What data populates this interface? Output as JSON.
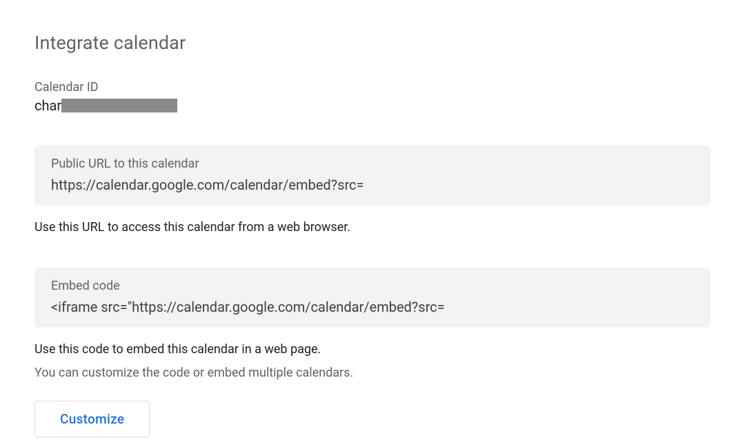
{
  "section": {
    "title": "Integrate calendar"
  },
  "calendar_id": {
    "label": "Calendar ID",
    "visible_prefix": "char"
  },
  "public_url": {
    "label": "Public URL to this calendar",
    "value": "https://calendar.google.com/calendar/embed?src=",
    "helper": "Use this URL to access this calendar from a web browser."
  },
  "embed_code": {
    "label": "Embed code",
    "value": "<iframe src=\"https://calendar.google.com/calendar/embed?src=",
    "helper_primary": "Use this code to embed this calendar in a web page.",
    "helper_secondary": "You can customize the code or embed multiple calendars."
  },
  "buttons": {
    "customize": "Customize"
  }
}
